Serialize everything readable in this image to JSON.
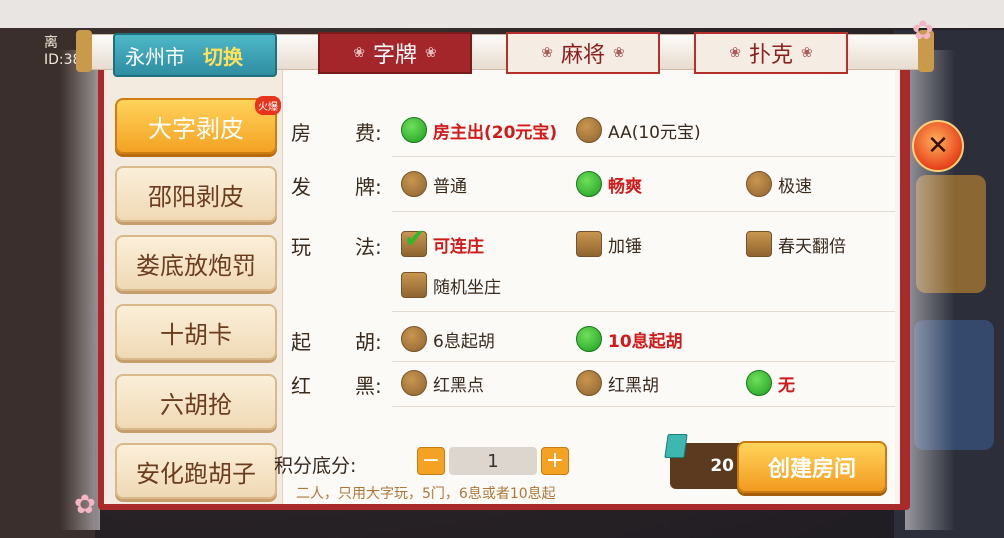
{
  "city": {
    "name": "永州市",
    "switch_label": "切换"
  },
  "bg": {
    "left_text_1": "离",
    "left_text_2": "ID:38"
  },
  "tabs": [
    {
      "label": "字牌",
      "active": true
    },
    {
      "label": "麻将",
      "active": false
    },
    {
      "label": "扑克",
      "active": false
    }
  ],
  "games": [
    {
      "label": "大字剥皮",
      "active": true,
      "badge": "火爆"
    },
    {
      "label": "邵阳剥皮",
      "active": false
    },
    {
      "label": "娄底放炮罚",
      "active": false
    },
    {
      "label": "十胡卡",
      "active": false
    },
    {
      "label": "六胡抢",
      "active": false
    },
    {
      "label": "安化跑胡子",
      "active": false
    }
  ],
  "rules": {
    "fee": {
      "label_a": "房",
      "label_b": "费:",
      "options": [
        "房主出(20元宝)",
        "AA(10元宝)"
      ],
      "selected": 0
    },
    "deal": {
      "label_a": "发",
      "label_b": "牌:",
      "options": [
        "普通",
        "畅爽",
        "极速"
      ],
      "selected": 1
    },
    "play": {
      "label_a": "玩",
      "label_b": "法:",
      "options": [
        "可连庄",
        "加锤",
        "春天翻倍",
        "随机坐庄"
      ],
      "checked": [
        true,
        false,
        false,
        false
      ]
    },
    "start": {
      "label_a": "起",
      "label_b": "胡:",
      "options": [
        "6息起胡",
        "10息起胡"
      ],
      "selected": 1
    },
    "redblack": {
      "label_a": "红",
      "label_b": "黑:",
      "options": [
        "红黑点",
        "红黑胡",
        "无"
      ],
      "selected": 2
    }
  },
  "score": {
    "label": "积分底分:",
    "value": "1",
    "minus": "−",
    "plus": "+"
  },
  "description": "二人，只用大字玩，5门，6息或者10息起",
  "cost": "20",
  "create_label": "创建房间",
  "close_label": "✕",
  "colors": {
    "panel_red": "#a92a2a",
    "selected_text": "#d11a1a",
    "accent_orange": "#f3a223"
  }
}
